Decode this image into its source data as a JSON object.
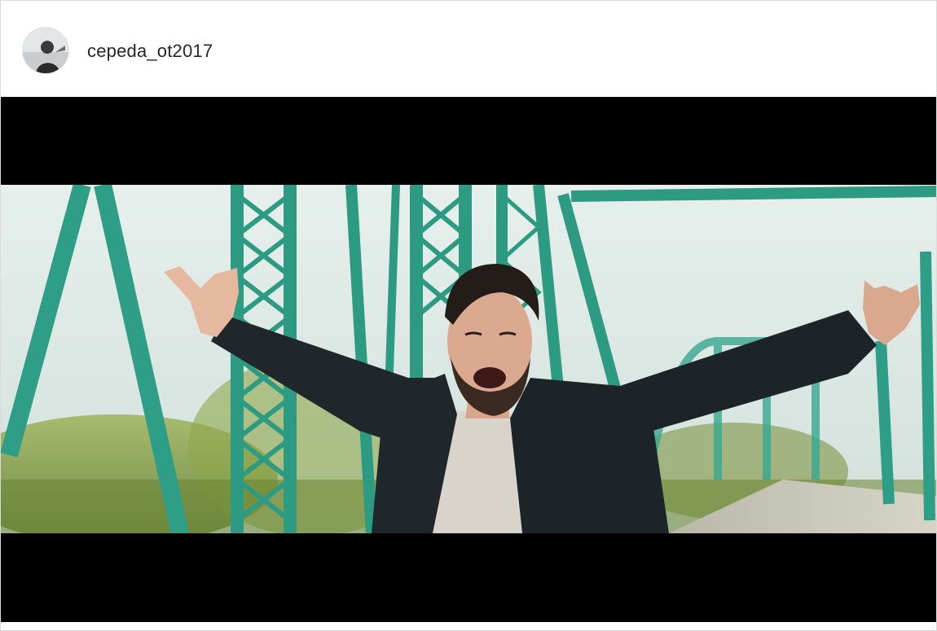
{
  "post": {
    "username": "cepeda_ot2017"
  },
  "media": {
    "kind": "video-still",
    "letterbox_color": "#000000",
    "scene_colors": {
      "sky": "#dde8e4",
      "bridge": "#2f9e86",
      "foliage": "#7a9a3c",
      "jacket": "#1d2428",
      "shirt": "#d8d4cc"
    }
  },
  "icons": {
    "avatar": "user-avatar"
  }
}
